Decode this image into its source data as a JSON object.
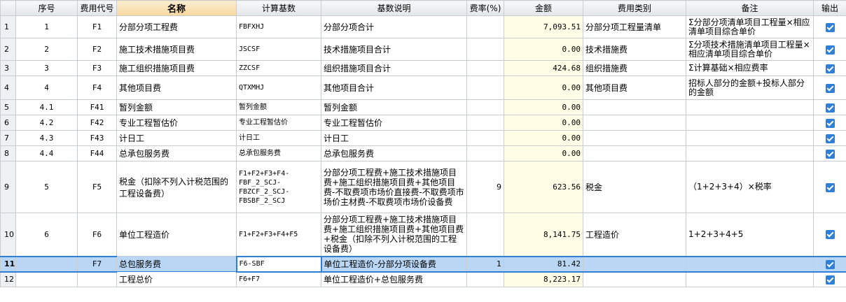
{
  "headers": {
    "rownum": "",
    "seq": "序号",
    "code": "费用代号",
    "name": "名称",
    "base": "计算基数",
    "desc": "基数说明",
    "rate": "费率(%)",
    "amount": "金额",
    "category": "费用类别",
    "note": "备注",
    "output": "输出"
  },
  "rows": [
    {
      "rownum": "1",
      "seq": "1",
      "code": "F1",
      "name": "分部分项工程费",
      "base": "FBFXHJ",
      "desc": "分部分项合计",
      "rate": "",
      "amount": "7,093.51",
      "category": "分部分项工程量清单",
      "note": "Σ分部分项清单项目工程量×相应清单项目综合单价",
      "output": true
    },
    {
      "rownum": "2",
      "seq": "2",
      "code": "F2",
      "name": "施工技术措施项目费",
      "base": "JSCSF",
      "desc": "技术措施项目合计",
      "rate": "",
      "amount": "0.00",
      "category": "技术措施费",
      "note": "Σ分项技术措施清单项目工程量×相应清单项目综合单价",
      "output": true
    },
    {
      "rownum": "3",
      "seq": "3",
      "code": "F3",
      "name": "施工组织措施项目费",
      "base": "ZZCSF",
      "desc": "组织措施项目合计",
      "rate": "",
      "amount": "424.68",
      "category": "组织措施费",
      "note": "Σ计算基础×相应费率",
      "output": true
    },
    {
      "rownum": "4",
      "seq": "4",
      "code": "F4",
      "name": "其他项目费",
      "base": "QTXMHJ",
      "desc": "其他项目合计",
      "rate": "",
      "amount": "0.00",
      "category": "其他项目费",
      "note": "招标人部分的金额+投标人部分的金额",
      "output": true
    },
    {
      "rownum": "5",
      "seq": "4.1",
      "code": "F41",
      "name": "暂列金额",
      "base": "暂列金额",
      "desc": "暂列金额",
      "rate": "",
      "amount": "0.00",
      "category": "",
      "note": "",
      "output": true
    },
    {
      "rownum": "6",
      "seq": "4.2",
      "code": "F42",
      "name": "专业工程暂估价",
      "base": "专业工程暂估价",
      "desc": "专业工程暂估价",
      "rate": "",
      "amount": "0.00",
      "category": "",
      "note": "",
      "output": true
    },
    {
      "rownum": "7",
      "seq": "4.3",
      "code": "F43",
      "name": "计日工",
      "base": "计日工",
      "desc": "计日工",
      "rate": "",
      "amount": "0.00",
      "category": "",
      "note": "",
      "output": true
    },
    {
      "rownum": "8",
      "seq": "4.4",
      "code": "F44",
      "name": "总承包服务费",
      "base": "总承包服务费",
      "desc": "总承包服务费",
      "rate": "",
      "amount": "0.00",
      "category": "",
      "note": "",
      "output": true
    },
    {
      "rownum": "9",
      "seq": "5",
      "code": "F5",
      "name": "税金（扣除不列入计税范围的工程设备费）",
      "base": "F1+F2+F3+F4-\nFBF_2_SCJ-\nFBZCF_2_SCJ-\nFBSBF_2_SCJ",
      "desc": "分部分项工程费+施工技术措施项目费+施工组织措施项目费+其他项目费-不取费项市场价直接费-不取费项市场价主材费-不取费项市场价设备费",
      "rate": "9",
      "amount": "623.56",
      "category": "税金",
      "note": "（1+2+3+4）×税率",
      "output": true
    },
    {
      "rownum": "10",
      "seq": "6",
      "code": "F6",
      "name": "单位工程造价",
      "base": "F1+F2+F3+F4+F5",
      "desc": "分部分项工程费+施工技术措施项目费+施工组织措施项目费+其他项目费+税金（扣除不列入计税范围的工程设备费）",
      "rate": "",
      "amount": "8,141.75",
      "category": "工程造价",
      "note": "1+2+3+4+5",
      "output": true
    },
    {
      "rownum": "11",
      "seq": "",
      "code": "F7",
      "name": "总包服务费",
      "base": "F6-SBF",
      "desc": "单位工程造价-分部分项设备费",
      "rate": "1",
      "amount": "81.42",
      "category": "",
      "note": "",
      "output": true,
      "selected": true
    },
    {
      "rownum": "12",
      "seq": "",
      "code": "",
      "name": "工程总价",
      "base": "F6+F7",
      "desc": "单位工程造价+总包服务费",
      "rate": "",
      "amount": "8,223.17",
      "category": "",
      "note": "",
      "output": true
    }
  ]
}
